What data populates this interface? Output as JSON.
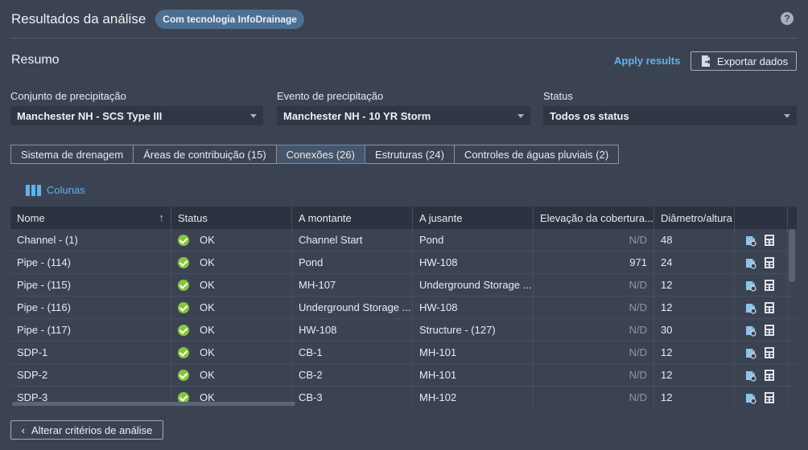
{
  "header": {
    "title": "Resultados da análise",
    "badge": "Com tecnologia InfoDrainage",
    "help_icon": "question-circle-icon"
  },
  "summary": {
    "title": "Resumo",
    "apply_label": "Apply results",
    "export_label": "Exportar dados"
  },
  "filters": {
    "rain_set_label": "Conjunto de precipitação",
    "rain_set_value": "Manchester NH - SCS Type III",
    "rain_event_label": "Evento de precipitação",
    "rain_event_value": "Manchester NH - 10 YR Storm",
    "status_label": "Status",
    "status_value": "Todos os status"
  },
  "tabs": [
    {
      "label": "Sistema de drenagem",
      "active": false
    },
    {
      "label": "Áreas de contribuição (15)",
      "active": false
    },
    {
      "label": "Conexões (26)",
      "active": true
    },
    {
      "label": "Estruturas (24)",
      "active": false
    },
    {
      "label": "Controles de águas pluviais (2)",
      "active": false
    }
  ],
  "columns_label": "Colunas",
  "table": {
    "headers": [
      "Nome",
      "Status",
      "A montante",
      "A jusante",
      "Elevação da cobertura...",
      "Diâmetro/altura"
    ],
    "rows": [
      {
        "nome": "Channel - (1)",
        "status": "OK",
        "montante": "Channel Start",
        "jusante": "Pond",
        "elevacao": "N/D",
        "diametro": "48"
      },
      {
        "nome": "Pipe - (114)",
        "status": "OK",
        "montante": "Pond",
        "jusante": "HW-108",
        "elevacao": "971",
        "diametro": "24"
      },
      {
        "nome": "Pipe - (115)",
        "status": "OK",
        "montante": "MH-107",
        "jusante": "Underground Storage ...",
        "elevacao": "N/D",
        "diametro": "12"
      },
      {
        "nome": "Pipe - (116)",
        "status": "OK",
        "montante": "Underground Storage ...",
        "jusante": "HW-108",
        "elevacao": "N/D",
        "diametro": "12"
      },
      {
        "nome": "Pipe - (117)",
        "status": "OK",
        "montante": "HW-108",
        "jusante": "Structure - (127)",
        "elevacao": "N/D",
        "diametro": "30"
      },
      {
        "nome": "SDP-1",
        "status": "OK",
        "montante": "CB-1",
        "jusante": "MH-101",
        "elevacao": "N/D",
        "diametro": "12"
      },
      {
        "nome": "SDP-2",
        "status": "OK",
        "montante": "CB-2",
        "jusante": "MH-101",
        "elevacao": "N/D",
        "diametro": "12"
      },
      {
        "nome": "SDP-3",
        "status": "OK",
        "montante": "CB-3",
        "jusante": "MH-102",
        "elevacao": "N/D",
        "diametro": "12"
      }
    ]
  },
  "back_label": "Alterar critérios de análise",
  "colors": {
    "background": "#3b4353",
    "accent": "#5fb2f0",
    "ok_green": "#87c540",
    "active_tab": "#47556b"
  }
}
